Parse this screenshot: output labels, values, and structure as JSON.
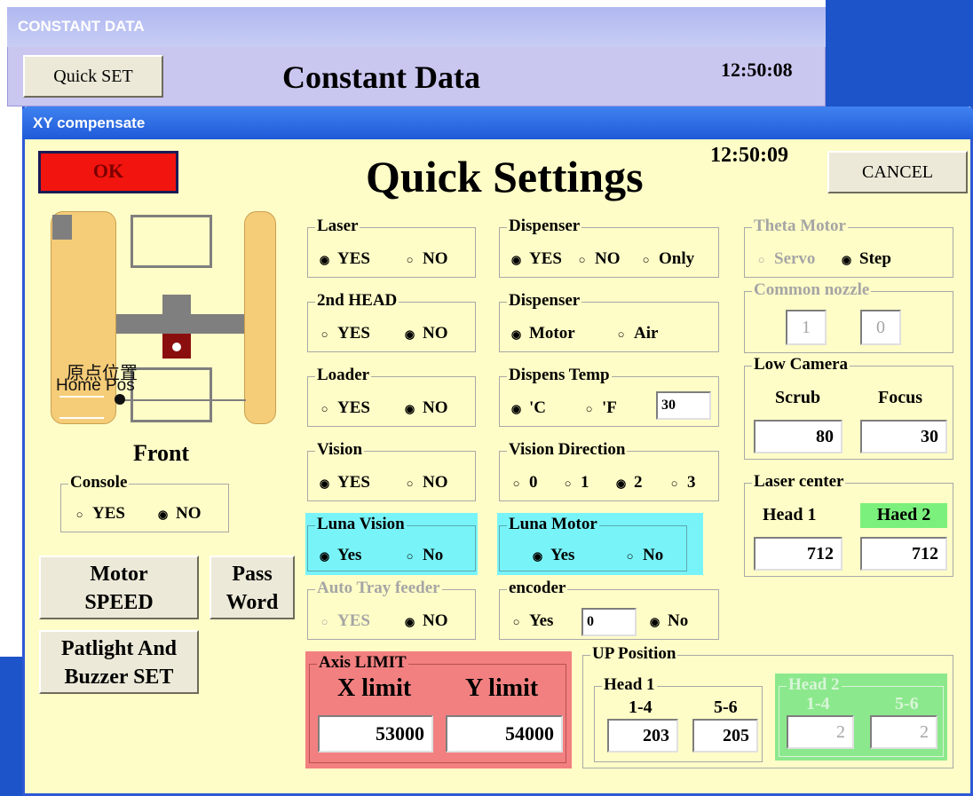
{
  "background_window": {
    "title": "CONSTANT DATA",
    "quick_set_label": "Quick SET",
    "heading": "Constant Data",
    "time": "12:50:08"
  },
  "dialog": {
    "title": "XY compensate",
    "ok_label": "OK",
    "heading": "Quick Settings",
    "time": "12:50:09",
    "cancel_label": "CANCEL"
  },
  "diagram": {
    "origin_label_cn": "原点位置",
    "origin_label_en": "Home Pos",
    "front_label": "Front"
  },
  "console": {
    "title": "Console",
    "yes": "YES",
    "no": "NO",
    "selected": "NO"
  },
  "buttons": {
    "motor_speed_1": "Motor",
    "motor_speed_2": "SPEED",
    "password_1": "Pass",
    "password_2": "Word",
    "patlight_1": "Patlight And",
    "patlight_2": "Buzzer SET"
  },
  "laser": {
    "title": "Laser",
    "yes": "YES",
    "no": "NO",
    "selected": "YES"
  },
  "second_head": {
    "title": "2nd HEAD",
    "yes": "YES",
    "no": "NO",
    "selected": "NO"
  },
  "loader": {
    "title": "Loader",
    "yes": "YES",
    "no": "NO",
    "selected": "NO"
  },
  "vision": {
    "title": "Vision",
    "yes": "YES",
    "no": "NO",
    "selected": "YES"
  },
  "luna_vision": {
    "title": "Luna Vision",
    "yes": "Yes",
    "no": "No",
    "selected": "Yes"
  },
  "auto_tray": {
    "title": "Auto Tray feeder",
    "yes": "YES",
    "no": "NO",
    "selected": "NO"
  },
  "dispenser": {
    "title": "Dispenser",
    "yes": "YES",
    "no": "NO",
    "only": "Only",
    "selected": "YES"
  },
  "dispenser_type": {
    "title": "Dispenser",
    "motor": "Motor",
    "air": "Air",
    "selected": "Motor"
  },
  "dispens_temp": {
    "title": "Dispens Temp",
    "c": "'C",
    "f": "'F",
    "value": "30",
    "selected": "'C"
  },
  "vision_direction": {
    "title": "Vision Direction",
    "o0": "0",
    "o1": "1",
    "o2": "2",
    "o3": "3",
    "selected": "2"
  },
  "luna_motor": {
    "title": "Luna Motor",
    "yes": "Yes",
    "no": "No",
    "selected": "Yes"
  },
  "encoder": {
    "title": "encoder",
    "yes": "Yes",
    "value": "0",
    "no": "No",
    "selected": "No"
  },
  "theta_motor": {
    "title": "Theta Motor",
    "servo": "Servo",
    "step": "Step",
    "selected": "Step"
  },
  "common_nozzle": {
    "title": "Common nozzle",
    "v1": "1",
    "v2": "0"
  },
  "low_camera": {
    "title": "Low Camera",
    "scrub_label": "Scrub",
    "focus_label": "Focus",
    "scrub": "80",
    "focus": "30"
  },
  "laser_center": {
    "title": "Laser center",
    "head1_label": "Head 1",
    "head2_label": "Haed 2",
    "head1": "712",
    "head2": "712",
    "head2_color": "#7cf07c"
  },
  "axis_limit": {
    "title": "Axis LIMIT",
    "x_label": "X limit",
    "y_label": "Y limit",
    "x": "53000",
    "y": "54000",
    "color": "#f28080"
  },
  "up_position": {
    "title": "UP Position",
    "head1": {
      "title": "Head 1",
      "a_label": "1-4",
      "b_label": "5-6",
      "a": "203",
      "b": "205"
    },
    "head2": {
      "title": "Head 2",
      "a_label": "1-4",
      "b_label": "5-6",
      "a": "2",
      "b": "2",
      "color": "#8ce88c"
    }
  }
}
